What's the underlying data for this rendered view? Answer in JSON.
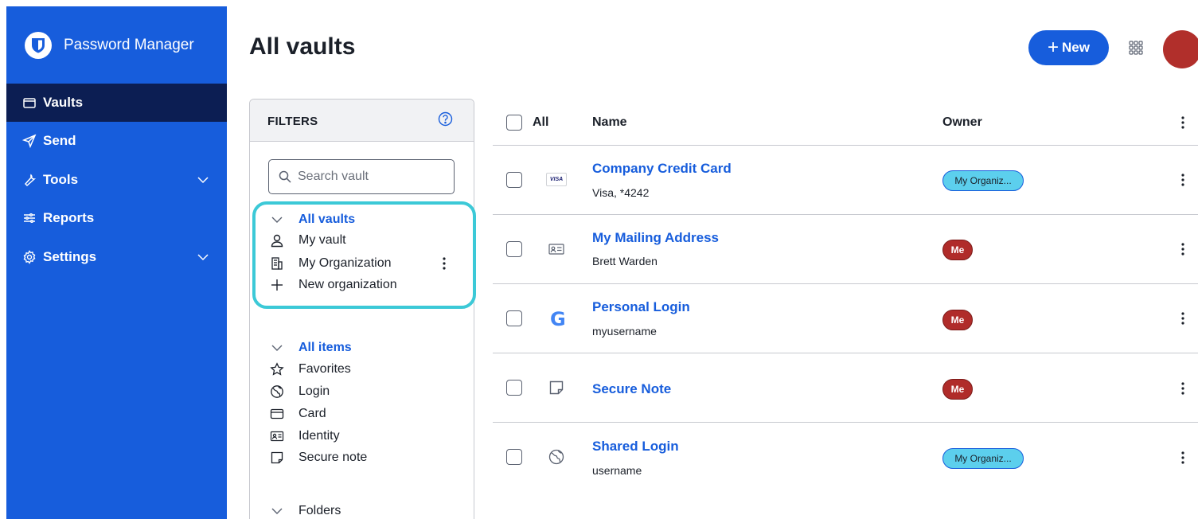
{
  "app": {
    "brand": "Password Manager"
  },
  "sidebar": {
    "items": [
      {
        "label": "Vaults",
        "icon": "vault-icon",
        "active": true
      },
      {
        "label": "Send",
        "icon": "send-icon"
      },
      {
        "label": "Tools",
        "icon": "wrench-icon",
        "expandable": true
      },
      {
        "label": "Reports",
        "icon": "sliders-icon"
      },
      {
        "label": "Settings",
        "icon": "gear-icon",
        "expandable": true
      }
    ]
  },
  "header": {
    "title": "All vaults",
    "new_label": "New",
    "new_plus": "+"
  },
  "filters": {
    "title": "FILTERS",
    "search_placeholder": "Search vault",
    "vaults": {
      "heading": "All vaults",
      "items": [
        "My vault",
        "My Organization",
        "New organization"
      ]
    },
    "types": {
      "heading": "All items",
      "items": [
        "Favorites",
        "Login",
        "Card",
        "Identity",
        "Secure note"
      ]
    },
    "folders_heading": "Folders"
  },
  "table": {
    "columns": {
      "all": "All",
      "name": "Name",
      "owner": "Owner"
    },
    "rows": [
      {
        "name": "Company Credit Card",
        "sub": "Visa, *4242",
        "type": "card",
        "owner": "My Organiz...",
        "owner_kind": "org",
        "visa": "VISA"
      },
      {
        "name": "My Mailing Address",
        "sub": "Brett Warden",
        "type": "identity",
        "owner": "Me",
        "owner_kind": "me"
      },
      {
        "name": "Personal Login",
        "sub": "myusername",
        "type": "google",
        "owner": "Me",
        "owner_kind": "me",
        "glyph": "G"
      },
      {
        "name": "Secure Note",
        "sub": "",
        "type": "note",
        "owner": "Me",
        "owner_kind": "me"
      },
      {
        "name": "Shared Login",
        "sub": "username",
        "type": "globe",
        "owner": "My Organiz...",
        "owner_kind": "org"
      }
    ]
  },
  "colors": {
    "brand": "#175ddc",
    "sidebar_active": "#0c1e53",
    "highlight": "#3cc9d7",
    "me_badge": "#b02c2a",
    "org_badge": "#5ccfed"
  }
}
